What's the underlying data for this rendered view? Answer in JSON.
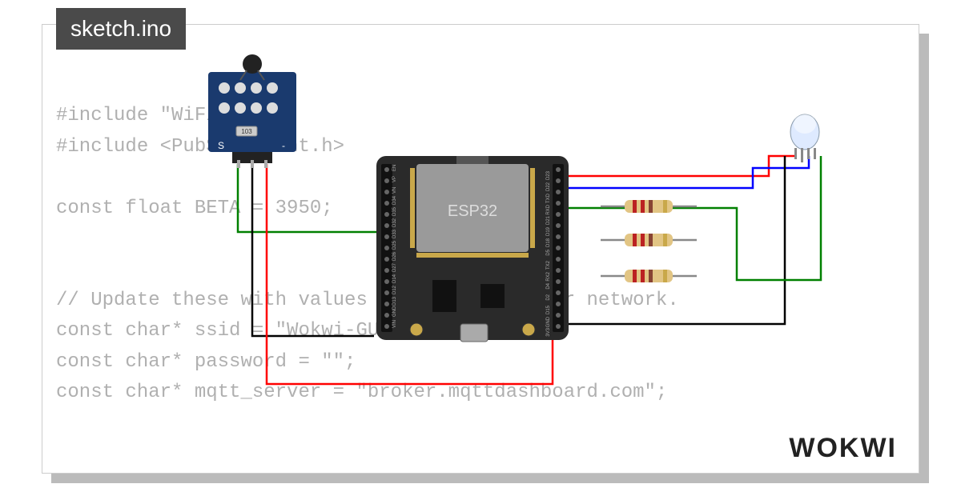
{
  "tab": {
    "filename": "sketch.ino"
  },
  "code": {
    "line1": "#include \"WiFi.h\"",
    "line2": "#include <PubSubClient.h>",
    "line3": "",
    "line4": "const float BETA = 3950;",
    "line5": "",
    "line6": "",
    "line7": "// Update these with values suitable for your network.",
    "line8": "const char* ssid = \"Wokwi-GUEST\";",
    "line9": "const char* password = \"\";",
    "line10": "const char* mqtt_server = \"broker.mqttdashboard.com\";"
  },
  "board": {
    "chip_label": "ESP32",
    "pins_top": [
      "EN",
      "VP",
      "VN",
      "D34",
      "D35",
      "D32",
      "D33",
      "D25",
      "D26",
      "D27",
      "D14",
      "D12",
      "D13",
      "GND",
      "VIN"
    ],
    "pins_bottom": [
      "D23",
      "D22",
      "TXD",
      "RXD",
      "D21",
      "D19",
      "D18",
      "D5",
      "TX2",
      "RX2",
      "D4",
      "D2",
      "D15",
      "GND",
      "3V3"
    ]
  },
  "sensor": {
    "pin_left": "S",
    "pin_right": "-",
    "smd_label": "103"
  },
  "logo": {
    "text": "WOKWI"
  },
  "colors": {
    "wire_red": "#ff0000",
    "wire_green": "#008000",
    "wire_blue": "#0000ff",
    "wire_black": "#000000",
    "pcb_blue": "#1a3a6e",
    "board_black": "#2a2a2a",
    "chip_grey": "#888888",
    "resistor_body": "#e2c584"
  }
}
